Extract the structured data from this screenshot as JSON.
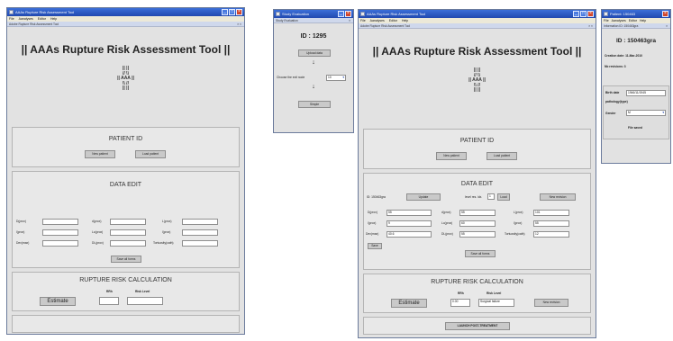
{
  "main_window": {
    "title": "AAAs Rupture Risk Assessment Tool",
    "menu": [
      "File",
      "Aanalyses",
      "Editor",
      "Help"
    ],
    "subtitle": "Adobe Rupture Risk Assessment Tool",
    "app_title": "|| AAAs Rupture Risk Assessment Tool ||",
    "logo": [
      "|| ||",
      "// \\\\",
      "|| AAA ||",
      "\\\\ //",
      "|| ||"
    ],
    "patient_id": {
      "title": "PATIENT ID",
      "new_button": "New patient",
      "load_button": "Load patient"
    },
    "data_edit": {
      "title": "DATA EDIT",
      "rows": [
        [
          {
            "label": "D(prox)",
            "value": ""
          },
          {
            "label": "d(prox)",
            "value": ""
          },
          {
            "label": "L(prox)",
            "value": ""
          }
        ],
        [
          {
            "label": "l(prox)",
            "value": ""
          },
          {
            "label": "Lo(prox)",
            "value": ""
          },
          {
            "label": "l(prox)",
            "value": ""
          }
        ],
        [
          {
            "label": "Dex(max)",
            "value": ""
          },
          {
            "label": "DL(prox)",
            "value": ""
          },
          {
            "label": "Tortuosity(cath)",
            "value": ""
          }
        ]
      ],
      "save_button": "Save all forms"
    },
    "rupture": {
      "title": "RUPTURE RISK CALCULATION",
      "estimate_button": "Estimate",
      "rrh_label": "RRh",
      "risk_label": "Risk Level",
      "rrh_value": "",
      "risk_value": ""
    }
  },
  "dialog": {
    "title": "Study Evaluation",
    "subtitle": "Study Evaluation",
    "id_label": "ID : 1295",
    "upload_button": "Upload data",
    "arrow1": "↓",
    "choose_label": "Choose the exit node",
    "choose_value": "10",
    "arrow2": "↓",
    "simple_button": "Simple"
  },
  "second_window": {
    "title": "AAAs Rupture Risk Assessment Tool",
    "menu": [
      "File",
      "Aanalyses",
      "Editor",
      "Help"
    ],
    "subtitle": "Adobe Rupture Risk Assessment Tool",
    "app_title": "|| AAAs Rupture Risk Assessment Tool ||",
    "logo": [
      "|| ||",
      "// \\\\",
      "|| AAA ||",
      "\\\\ //",
      "|| ||"
    ],
    "patient_id": {
      "title": "PATIENT ID",
      "new_button": "New patient",
      "load_button": "Load patient"
    },
    "data_edit": {
      "title": "DATA EDIT",
      "id_label": "ID: 150463gra",
      "update_button": "Update",
      "level_label": "level res. idx.",
      "level_value": "1",
      "load_button": "Load",
      "new_revision_button": "New revision",
      "rows": [
        [
          {
            "label": "D(prox)",
            "value": "55"
          },
          {
            "label": "d(prox)",
            "value": "55"
          },
          {
            "label": "L(prox)",
            "value": "101"
          }
        ],
        [
          {
            "label": "l(prox)",
            "value": "9"
          },
          {
            "label": "Lo(prox)",
            "value": "60"
          },
          {
            "label": "l(prox)",
            "value": "55"
          }
        ],
        [
          {
            "label": "Dex(max)",
            "value": "40.6"
          },
          {
            "label": "DL(prox)",
            "value": "55"
          },
          {
            "label": "Tortuosity(cath)",
            "value": "12"
          }
        ]
      ],
      "save_button": "Save all forms",
      "small_button": "Save"
    },
    "rupture": {
      "title": "RUPTURE RISK CALCULATION",
      "estimate_button": "Estimate",
      "rrh_label": "RRh",
      "risk_label": "Risk Level",
      "rrh_value": "0.00",
      "risk_value": "Surgical failure",
      "next_button": "New revision"
    },
    "launch_button": "LAUNCH POST-TREATMENT"
  },
  "side_window": {
    "title": "Patient: 150463",
    "menu": [
      "File",
      "Aanalyses",
      "Editor",
      "Help"
    ],
    "subtitle": "Information ID: 150463gra",
    "id_label": "ID : 150463gra",
    "creation_label": "Creation date: 11-Mar-2010",
    "revisions_label": "Nb revisions: 3",
    "birth_label": "Birth date",
    "birth_value": "1946/11/1945",
    "pathology_label": "pathology(type)",
    "gender_label": "Gender",
    "gender_value": "M",
    "save_label": "File saved"
  }
}
